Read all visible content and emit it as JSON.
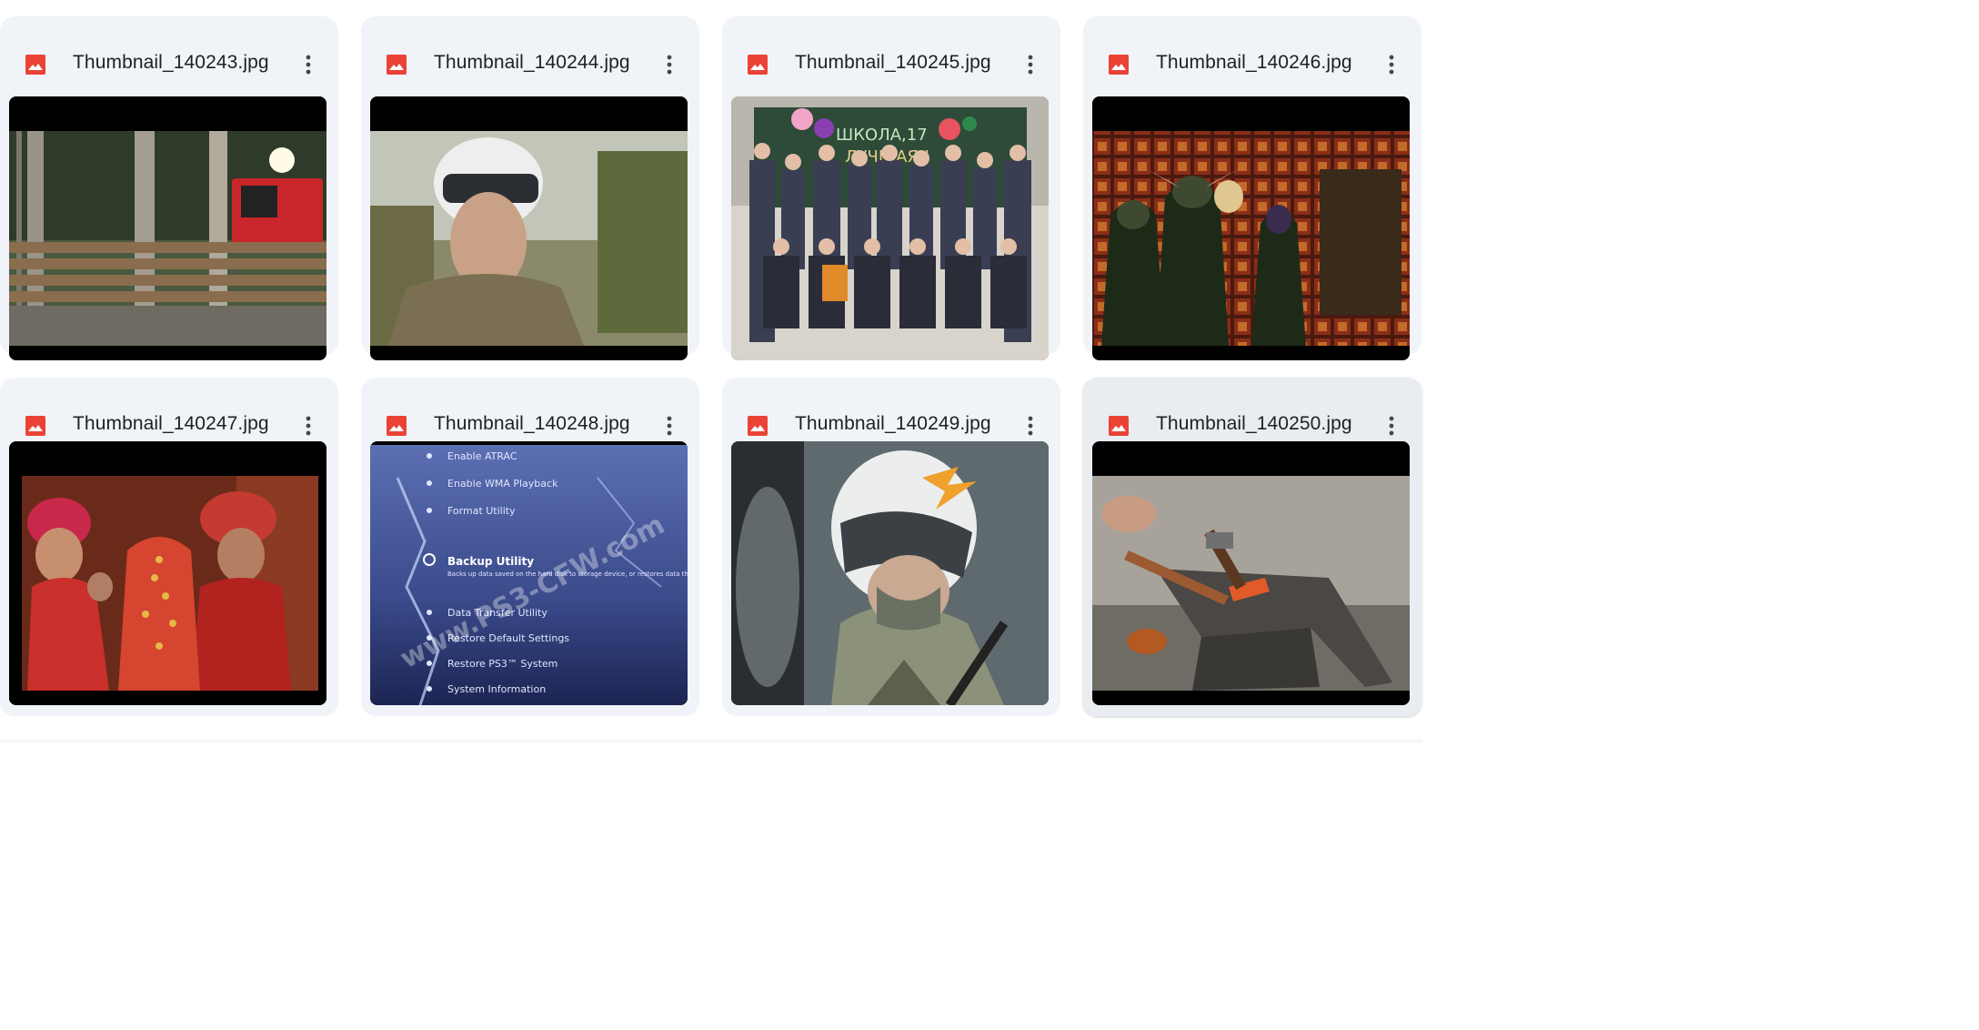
{
  "files": [
    {
      "name": "Thumbnail_140243.jpg",
      "icon": "image-file-icon",
      "scene": "forest-logging"
    },
    {
      "name": "Thumbnail_140244.jpg",
      "icon": "image-file-icon",
      "scene": "camo-helmet-man"
    },
    {
      "name": "Thumbnail_140245.jpg",
      "icon": "image-file-icon",
      "scene": "school-class-photo"
    },
    {
      "name": "Thumbnail_140246.jpg",
      "icon": "image-file-icon",
      "scene": "game-characters"
    },
    {
      "name": "Thumbnail_140247.jpg",
      "icon": "image-file-icon",
      "scene": "wedding-ceremony"
    },
    {
      "name": "Thumbnail_140248.jpg",
      "icon": "image-file-icon",
      "scene": "ps3-menu"
    },
    {
      "name": "Thumbnail_140249.jpg",
      "icon": "image-file-icon",
      "scene": "pilot-helmet"
    },
    {
      "name": "Thumbnail_140250.jpg",
      "icon": "image-file-icon",
      "scene": "blacksmith-anvil"
    }
  ],
  "thumb_text": {
    "chalkboard_line1": "ШКОЛА,17",
    "chalkboard_line2": "ЛУЧШАЯ !",
    "ps3_items": [
      "Enable ATRAC",
      "Enable WMA Playback",
      "Format Utility",
      "Backup Utility",
      "Data Transfer Utility",
      "Restore Default Settings",
      "Restore PS3™ System",
      "System Information"
    ],
    "ps3_desc": "Backs up data saved on the hard disk to storage device, or restores data that has",
    "ps3_watermark": "www.PS3-CFW.com"
  },
  "colors": {
    "card_bg": "#f0f4f9",
    "icon_red": "#ea4335",
    "text": "#1f1f1f"
  }
}
